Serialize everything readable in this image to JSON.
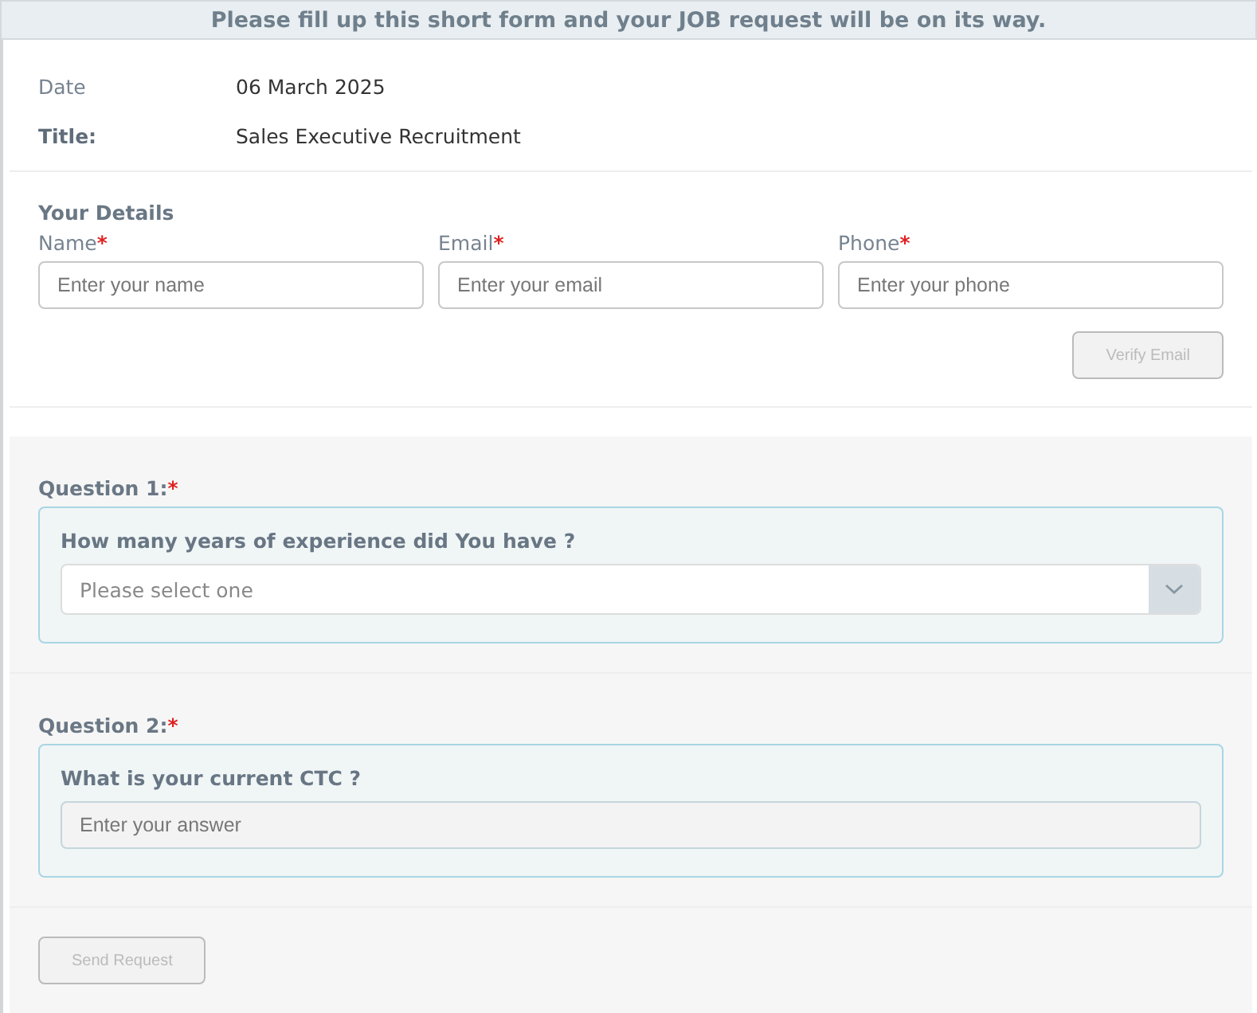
{
  "banner": "Please fill up this short form and your JOB request will be on its way.",
  "info": [
    {
      "label": "Date",
      "bold": false,
      "value": "06 March 2025"
    },
    {
      "label": "Title:",
      "bold": true,
      "value": "Sales Executive Recruitment"
    }
  ],
  "details": {
    "heading": "Your Details",
    "fields": [
      {
        "label": "Name",
        "mark": "*",
        "placeholder": "Enter your name"
      },
      {
        "label": "Email",
        "mark": "*",
        "placeholder": "Enter your email"
      },
      {
        "label": "Phone",
        "mark": "*",
        "placeholder": "Enter your phone"
      }
    ],
    "verify_button": {
      "label": "Verify Email",
      "disabled": true
    }
  },
  "questions": [
    {
      "label": "Question 1:",
      "mark": "*",
      "question": "How many years of experience did You have ?",
      "kind": "select",
      "placeholder": "Please select one"
    },
    {
      "label": "Question 2:",
      "mark": "*",
      "question": "What is your current CTC ?",
      "kind": "text",
      "placeholder": "Enter your answer"
    }
  ],
  "send_button": {
    "label": "Send Request",
    "disabled": true
  }
}
